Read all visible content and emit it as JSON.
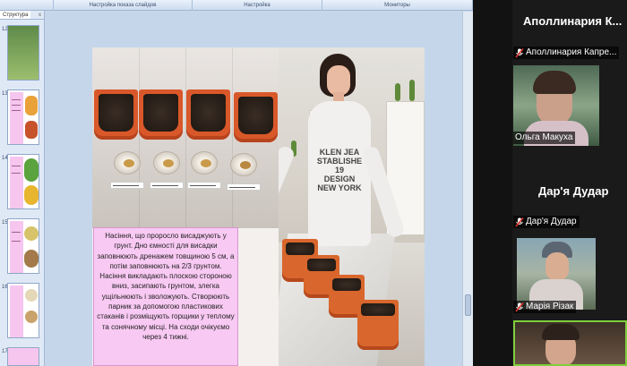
{
  "ribbon": {
    "group1": "",
    "group2": "Настройка показа слайдов",
    "group3": "Настройка",
    "group4": "Мониторы"
  },
  "outline": {
    "tab_label": "Структура",
    "close_label": "x",
    "slides": [
      {
        "num": "12"
      },
      {
        "num": "13"
      },
      {
        "num": "14"
      },
      {
        "num": "15"
      },
      {
        "num": "16"
      },
      {
        "num": "17"
      }
    ]
  },
  "slide": {
    "photo_text": "KLEN JEA\nSTABLISHE\n19\nDESIGN\nNEW YORK",
    "body_text": "Насіння, що проросло висаджують у грунт. Дно ємності для висадки заповнюють дренажем товщиною 5 см, а потім заповнюють на 2/3 грунтом. Насіння викладають плоскою стороною вниз, засипають грунтом, злегка ущільнюють і зволожують. Створюють парник за допомогою пластикових стаканів і розміщують горщики у теплому та сонячному місці. На сходи очікуємо через 4 тижні."
  },
  "participants": [
    {
      "name_tile": "Аполлинария К...",
      "label": "Аполлинария Капре..."
    },
    {
      "label": "Ольга Макуха"
    },
    {
      "name_tile": "Дар'я Дудар",
      "label": "Дар'я Дудар"
    },
    {
      "label": "Марія Різак"
    },
    {
      "label": ""
    }
  ],
  "colors": {
    "mute_red": "#e0342f",
    "active_speaker_border": "#7ecf3b",
    "textbox_pink": "#f8c9f3"
  }
}
